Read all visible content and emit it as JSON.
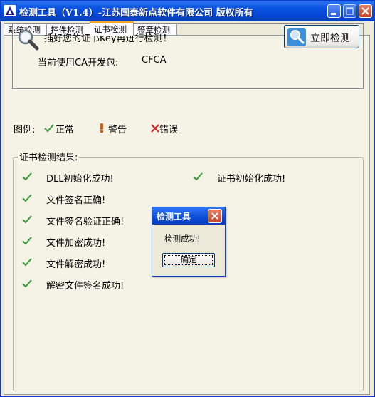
{
  "window": {
    "title": "检测工具（V1.4）-江苏国泰新点软件有限公司 版权所有",
    "accent": "#0a54e2"
  },
  "tabs": [
    {
      "label": "系统检测",
      "active": false
    },
    {
      "label": "控件检测",
      "active": false
    },
    {
      "label": "证书检测",
      "active": true
    },
    {
      "label": "签章检测",
      "active": false
    }
  ],
  "info": {
    "prompt": "插好您的证书Key再进行检测！",
    "ca_label": "当前使用CA开发包:",
    "ca_value": "CFCA",
    "check_button": "立即检测"
  },
  "legend": {
    "label": "图例:",
    "items": [
      {
        "label": "正常",
        "icon": "check-icon",
        "color": "#3a9a3a"
      },
      {
        "label": "警告",
        "icon": "exclamation-icon",
        "color": "#e05a10"
      },
      {
        "label": "错误",
        "icon": "x-icon",
        "color": "#d02020"
      }
    ]
  },
  "results": {
    "title": "证书检测结果:",
    "items": [
      {
        "label": "DLL初始化成功!",
        "status": "ok"
      },
      {
        "label": "证书初始化成功!",
        "status": "ok"
      },
      {
        "label": "文件签名正确!",
        "status": "ok"
      },
      {
        "label": "文件签名验证正确!",
        "status": "ok"
      },
      {
        "label": "文件加密成功!",
        "status": "ok"
      },
      {
        "label": "文件解密成功!",
        "status": "ok"
      },
      {
        "label": "解密文件签名成功!",
        "status": "ok"
      }
    ]
  },
  "dialog": {
    "title": "检测工具",
    "message": "检测成功!",
    "ok_label": "确定"
  }
}
